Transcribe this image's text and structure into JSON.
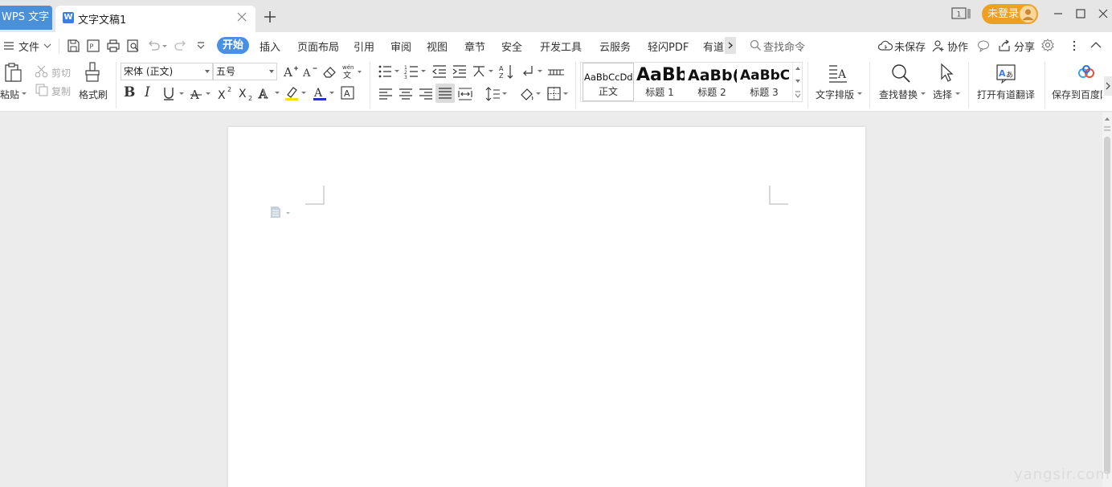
{
  "titlebar": {
    "app_tab": "WPS 文字",
    "doc_tab": "文字文稿1",
    "login": "未登录"
  },
  "menubar": {
    "file": "文件",
    "tabs": [
      "开始",
      "插入",
      "页面布局",
      "引用",
      "审阅",
      "视图",
      "章节",
      "安全",
      "开发工具",
      "云服务",
      "轻闪PDF",
      "有道"
    ],
    "search": "查找命令",
    "unsaved": "未保存",
    "collab": "协作",
    "share": "分享"
  },
  "ribbon": {
    "paste": "粘贴",
    "cut": "剪切",
    "copy": "复制",
    "format_painter": "格式刷",
    "font_name": "宋体 (正文)",
    "font_size": "五号",
    "styles": [
      {
        "preview": "AaBbCcDd",
        "name": "正文"
      },
      {
        "preview": "AaBb",
        "name": "标题 1"
      },
      {
        "preview": "AaBb(",
        "name": "标题 2"
      },
      {
        "preview": "AaBbC",
        "name": "标题 3"
      }
    ],
    "text_layout": "文字排版",
    "find_replace": "查找替换",
    "select": "选择",
    "translate": "打开有道翻译",
    "save_baidu": "保存到百度网"
  },
  "watermark": "yangsir.com",
  "colors": {
    "accent": "#4a90e2",
    "login": "#f0a020",
    "app_tab": "#4a90d9"
  }
}
